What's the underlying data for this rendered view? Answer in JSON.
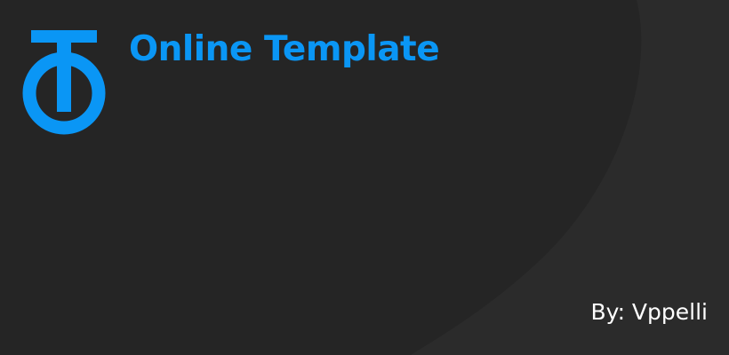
{
  "header": {
    "logo_icon": "ot-monogram-icon",
    "title": "Online Template"
  },
  "footer": {
    "author": "By: Vppelli"
  },
  "colors": {
    "background": "#2b2b2b",
    "background_shape": "#252525",
    "accent": "#0a96f5",
    "author_text": "#ffffff"
  }
}
